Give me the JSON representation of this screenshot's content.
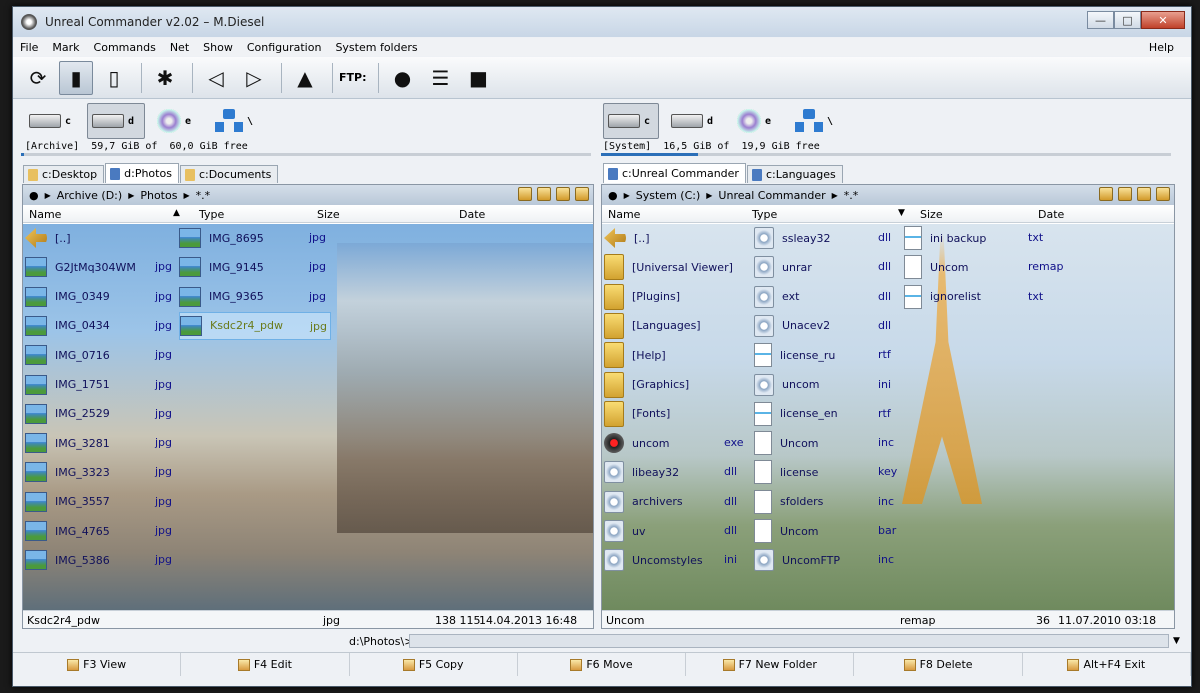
{
  "window": {
    "title": "Unreal Commander v2.02 – M.Diesel"
  },
  "menu": {
    "items": [
      "File",
      "Mark",
      "Commands",
      "Net",
      "Show",
      "Configuration",
      "System folders"
    ],
    "help": "Help"
  },
  "toolbar": {
    "ftp_label": "FTP:"
  },
  "left": {
    "drives": [
      {
        "letter": "c"
      },
      {
        "letter": "d"
      },
      {
        "letter": "e"
      },
      {
        "letter": "\\"
      }
    ],
    "drive_info": "[Archive]  59,7 GiB of  60,0 GiB free",
    "usage_fraction": 0.005,
    "tabs": [
      "c:Desktop",
      "d:Photos",
      "c:Documents"
    ],
    "path": [
      "Archive (D:)",
      "Photos",
      "*.*"
    ],
    "columns": {
      "name": "Name",
      "type": "Type",
      "size": "Size",
      "date": "Date"
    },
    "files_col1": [
      {
        "name": "[..]",
        "ext": "",
        "icon": "up-icon"
      },
      {
        "name": "G2JtMq304WM",
        "ext": "jpg",
        "icon": "image-icon"
      },
      {
        "name": "IMG_0349",
        "ext": "jpg",
        "icon": "image-icon"
      },
      {
        "name": "IMG_0434",
        "ext": "jpg",
        "icon": "image-icon"
      },
      {
        "name": "IMG_0716",
        "ext": "jpg",
        "icon": "image-icon"
      },
      {
        "name": "IMG_1751",
        "ext": "jpg",
        "icon": "image-icon"
      },
      {
        "name": "IMG_2529",
        "ext": "jpg",
        "icon": "image-icon"
      },
      {
        "name": "IMG_3281",
        "ext": "jpg",
        "icon": "image-icon"
      },
      {
        "name": "IMG_3323",
        "ext": "jpg",
        "icon": "image-icon"
      },
      {
        "name": "IMG_3557",
        "ext": "jpg",
        "icon": "image-icon"
      },
      {
        "name": "IMG_4765",
        "ext": "jpg",
        "icon": "image-icon"
      },
      {
        "name": "IMG_5386",
        "ext": "jpg",
        "icon": "image-icon"
      }
    ],
    "files_col2": [
      {
        "name": "IMG_8695",
        "ext": "jpg",
        "icon": "image-icon"
      },
      {
        "name": "IMG_9145",
        "ext": "jpg",
        "icon": "image-icon"
      },
      {
        "name": "IMG_9365",
        "ext": "jpg",
        "icon": "image-icon"
      },
      {
        "name": "Ksdc2r4_pdw",
        "ext": "jpg",
        "icon": "image-icon",
        "selected": true
      }
    ],
    "status": {
      "name": "Ksdc2r4_pdw",
      "type": "jpg",
      "size": "138 115",
      "date": "14.04.2013 16:48"
    }
  },
  "right": {
    "drives": [
      {
        "letter": "c"
      },
      {
        "letter": "d"
      },
      {
        "letter": "e"
      },
      {
        "letter": "\\"
      }
    ],
    "drive_info": "[System]  16,5 GiB of  19,9 GiB free",
    "usage_fraction": 0.17,
    "tabs": [
      "c:Unreal Commander",
      "c:Languages"
    ],
    "path": [
      "System (C:)",
      "Unreal Commander",
      "*.*"
    ],
    "columns": {
      "name": "Name",
      "type": "Type",
      "size": "Size",
      "date": "Date"
    },
    "files_col1": [
      {
        "name": "[..]",
        "ext": "",
        "icon": "up-icon"
      },
      {
        "name": "[Universal Viewer]",
        "ext": "",
        "icon": "folder-icon"
      },
      {
        "name": "[Plugins]",
        "ext": "",
        "icon": "folder-icon"
      },
      {
        "name": "[Languages]",
        "ext": "",
        "icon": "folder-icon"
      },
      {
        "name": "[Help]",
        "ext": "",
        "icon": "folder-icon"
      },
      {
        "name": "[Graphics]",
        "ext": "",
        "icon": "folder-icon"
      },
      {
        "name": "[Fonts]",
        "ext": "",
        "icon": "folder-icon"
      },
      {
        "name": "uncom",
        "ext": "exe",
        "icon": "exe-icon"
      },
      {
        "name": "libeay32",
        "ext": "dll",
        "icon": "gear-icon"
      },
      {
        "name": "archivers",
        "ext": "dll",
        "icon": "gear-icon"
      },
      {
        "name": "uv",
        "ext": "dll",
        "icon": "gear-icon"
      },
      {
        "name": "Uncomstyles",
        "ext": "ini",
        "icon": "gear-icon"
      }
    ],
    "files_col2": [
      {
        "name": "ssleay32",
        "ext": "dll",
        "icon": "gear-icon"
      },
      {
        "name": "unrar",
        "ext": "dll",
        "icon": "gear-icon"
      },
      {
        "name": "ext",
        "ext": "dll",
        "icon": "gear-icon"
      },
      {
        "name": "Unacev2",
        "ext": "dll",
        "icon": "gear-icon"
      },
      {
        "name": "license_ru",
        "ext": "rtf",
        "icon": "rtf-icon"
      },
      {
        "name": "uncom",
        "ext": "ini",
        "icon": "gear-icon"
      },
      {
        "name": "license_en",
        "ext": "rtf",
        "icon": "rtf-icon"
      },
      {
        "name": "Uncom",
        "ext": "inc",
        "icon": "doc-icon"
      },
      {
        "name": "license",
        "ext": "key",
        "icon": "doc-icon"
      },
      {
        "name": "sfolders",
        "ext": "inc",
        "icon": "doc-icon"
      },
      {
        "name": "Uncom",
        "ext": "bar",
        "icon": "doc-icon"
      },
      {
        "name": "UncomFTP",
        "ext": "inc",
        "icon": "gear-icon"
      }
    ],
    "files_col3": [
      {
        "name": "ini backup",
        "ext": "txt",
        "icon": "text-icon"
      },
      {
        "name": "Uncom",
        "ext": "remap",
        "icon": "doc-icon"
      },
      {
        "name": "ignorelist",
        "ext": "txt",
        "icon": "text-icon"
      }
    ],
    "status": {
      "name": "Uncom",
      "type": "remap",
      "size": "36",
      "date": "11.07.2010 03:18"
    }
  },
  "cmdline": {
    "path": "d:\\Photos\\>"
  },
  "fkeys": [
    "F3 View",
    "F4 Edit",
    "F5 Copy",
    "F6 Move",
    "F7 New Folder",
    "F8 Delete",
    "Alt+F4 Exit"
  ]
}
